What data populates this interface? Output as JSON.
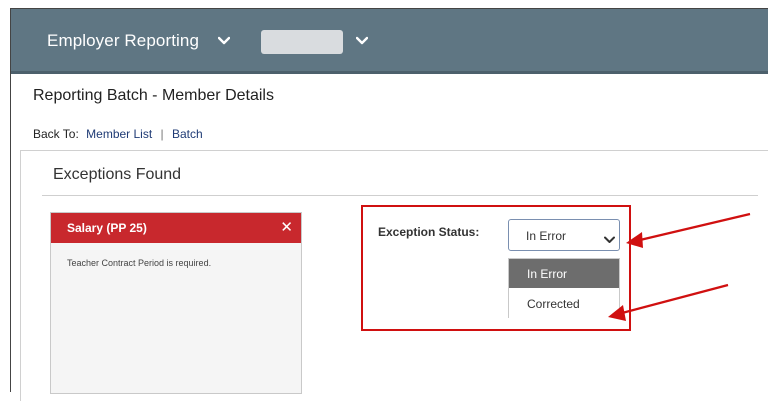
{
  "header": {
    "app_menu_label": "Employer Reporting",
    "org_selector_value": ""
  },
  "page": {
    "title": "Reporting Batch - Member Details",
    "back_to_label": "Back To:",
    "back_links": [
      "Member List",
      "Batch"
    ]
  },
  "exceptions": {
    "section_title": "Exceptions Found",
    "card": {
      "title": "Salary (PP 25)",
      "message": "Teacher Contract Period is required."
    },
    "status": {
      "label": "Exception Status:",
      "selected": "In Error",
      "options": [
        "In Error",
        "Corrected"
      ],
      "highlighted_option": "In Error"
    }
  },
  "colors": {
    "topbar": "#5f7683",
    "error_header": "#c8282d",
    "annotation": "#d01010",
    "link": "#1f3b75"
  },
  "icons": {
    "menu_chevron": "chevron-down-icon",
    "close": "close-icon",
    "select_chevron": "chevron-down-icon"
  }
}
